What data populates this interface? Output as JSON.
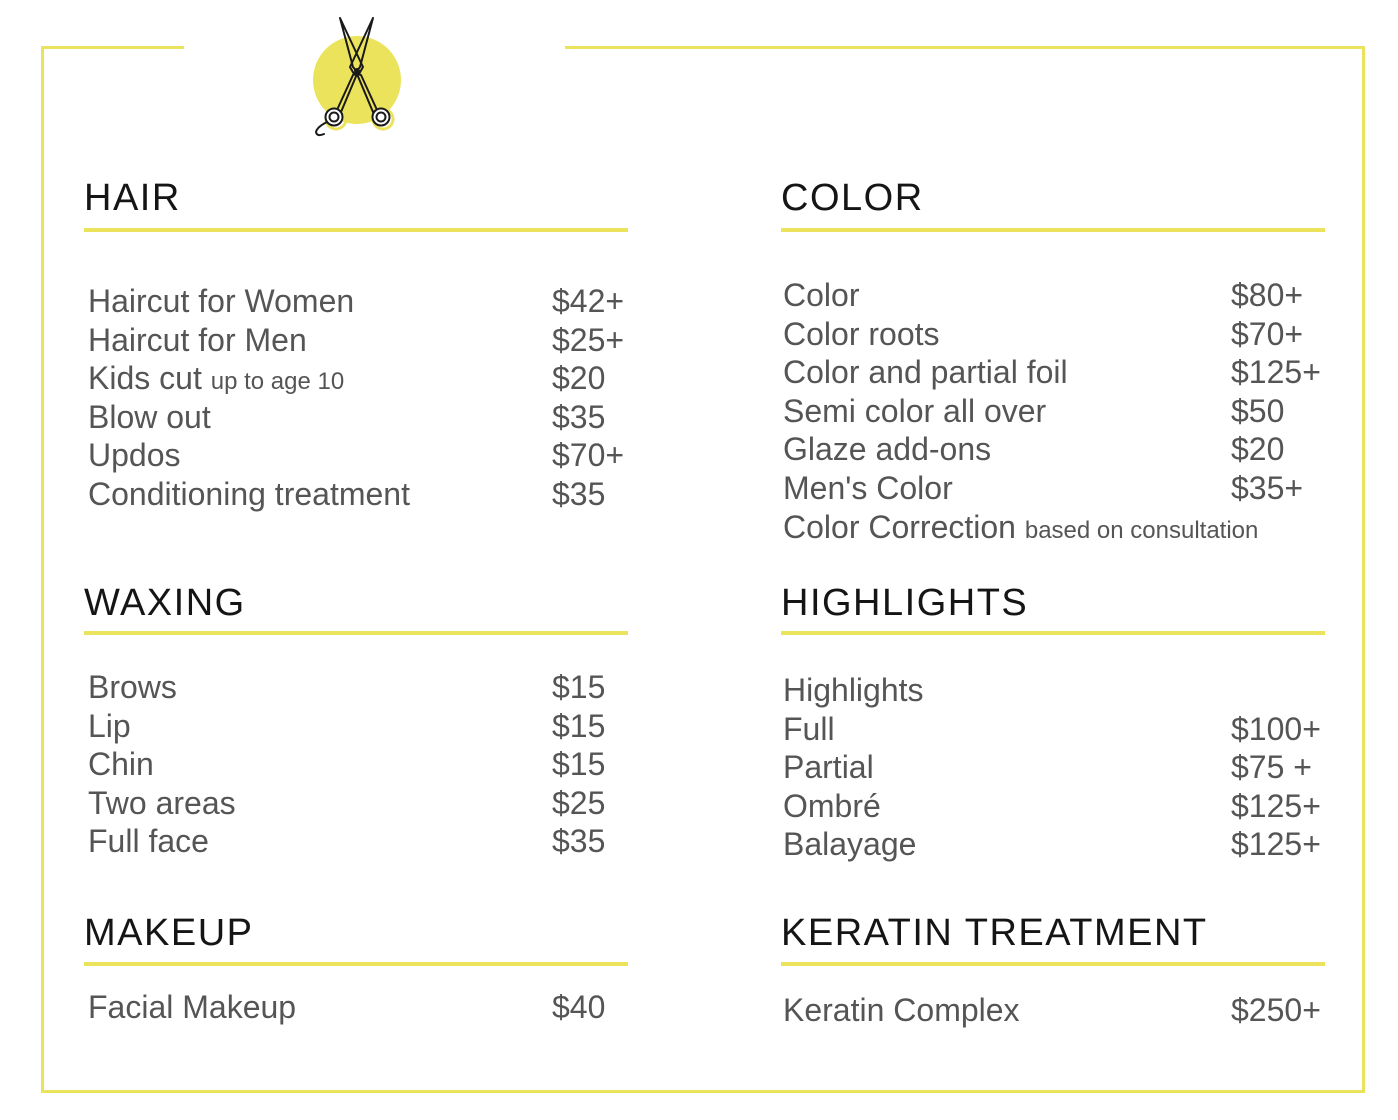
{
  "colors": {
    "accent": "#ece35c",
    "heading": "#151515",
    "text": "#555555"
  },
  "icons": {
    "logo": "scissors-icon"
  },
  "hair": {
    "title": "HAIR",
    "items": [
      {
        "name": "Haircut for Women",
        "price": "$42+"
      },
      {
        "name": "Haircut for Men",
        "price": "$25+"
      },
      {
        "name": "Kids cut",
        "note": "up to age 10",
        "price": "$20"
      },
      {
        "name": "Blow out",
        "price": "$35"
      },
      {
        "name": "Updos",
        "price": "$70+"
      },
      {
        "name": "Conditioning treatment",
        "price": "$35"
      }
    ]
  },
  "waxing": {
    "title": "WAXING",
    "items": [
      {
        "name": "Brows",
        "price": "$15"
      },
      {
        "name": "Lip",
        "price": "$15"
      },
      {
        "name": "Chin",
        "price": "$15"
      },
      {
        "name": "Two areas",
        "price": "$25"
      },
      {
        "name": "Full face",
        "price": "$35"
      }
    ]
  },
  "makeup": {
    "title": "MAKEUP",
    "items": [
      {
        "name": "Facial Makeup",
        "price": "$40"
      }
    ]
  },
  "color": {
    "title": "COLOR",
    "items": [
      {
        "name": "Color",
        "price": "$80+"
      },
      {
        "name": "Color roots",
        "price": "$70+"
      },
      {
        "name": "Color and partial foil",
        "price": "$125+"
      },
      {
        "name": "Semi color all over",
        "price": "$50"
      },
      {
        "name": "Glaze add-ons",
        "price": "$20"
      },
      {
        "name": "Men's Color",
        "price": "$35+"
      },
      {
        "name": "Color Correction",
        "note": "based on consultation"
      }
    ]
  },
  "highlights": {
    "title": "HIGHLIGHTS",
    "items": [
      {
        "name": "Highlights"
      },
      {
        "name": "Full",
        "price": "$100+"
      },
      {
        "name": "Partial",
        "price": "$75 +"
      },
      {
        "name": "Ombré",
        "price": "$125+"
      },
      {
        "name": "Balayage",
        "price": "$125+"
      }
    ]
  },
  "keratin": {
    "title": "KERATIN TREATMENT",
    "items": [
      {
        "name": "Keratin Complex",
        "price": "$250+"
      }
    ]
  }
}
